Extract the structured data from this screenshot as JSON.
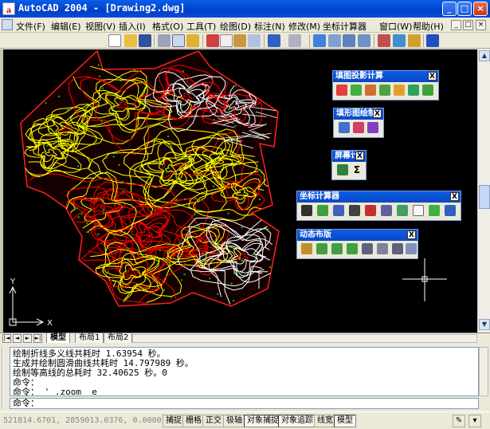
{
  "window": {
    "title": "AutoCAD 2004 - [Drawing2.dwg]",
    "app_icon": "a",
    "minimize": "_",
    "maximize": "□",
    "close": "×"
  },
  "menu": {
    "items": [
      "文件(F)",
      "编辑(E)",
      "视图(V)",
      "插入(I)",
      "格式(O)",
      "工具(T)",
      "绘图(D)",
      "标注(N)",
      "修改(M)",
      "坐标计算器",
      "窗口(W)",
      "帮助(H)"
    ],
    "mdi_min": "_",
    "mdi_max": "□",
    "mdi_close": "×"
  },
  "palettes": {
    "p1": {
      "title": "填图投影计算",
      "close": "X"
    },
    "p2": {
      "title": "填形图绘制",
      "close": "X"
    },
    "p3": {
      "title": "屏幕计",
      "close": "X",
      "sigma": "Σ"
    },
    "p4": {
      "title": "坐标计算器",
      "close": "X"
    },
    "p5": {
      "title": "动态布版",
      "close": "X"
    }
  },
  "ucs": {
    "x_label": "X",
    "y_label": "Y"
  },
  "tabs": {
    "nav": [
      "|◄",
      "◄",
      "►",
      "►|"
    ],
    "items": [
      "模型",
      "布局1",
      "布局2"
    ],
    "active_index": 0
  },
  "command": {
    "lines": [
      "绘制折线多义线共耗时 1.63954 秒。",
      "生成并绘制圆滑曲线共耗时 14.797989 秒。",
      "绘制等高线的总耗时 32.40625 秒。0",
      "命令：",
      "命令： '_.zoom _e"
    ],
    "prompt": "命令："
  },
  "status": {
    "coords": "521814.6701,  2859013.0376,  0.0000",
    "buttons": [
      "捕捉",
      "栅格",
      "正交",
      "极轴",
      "对象捕捉",
      "对象追踪",
      "线宽",
      "模型"
    ],
    "active": [
      "对象捕捉",
      "对象追踪",
      "模型"
    ]
  },
  "colors": {
    "canvas": "#000000",
    "contour_yellow": "#ffff00",
    "contour_red": "#ff0000",
    "contour_white": "#ffffff",
    "contour_green": "#00c800",
    "title_blue": "#0a5ee8"
  }
}
